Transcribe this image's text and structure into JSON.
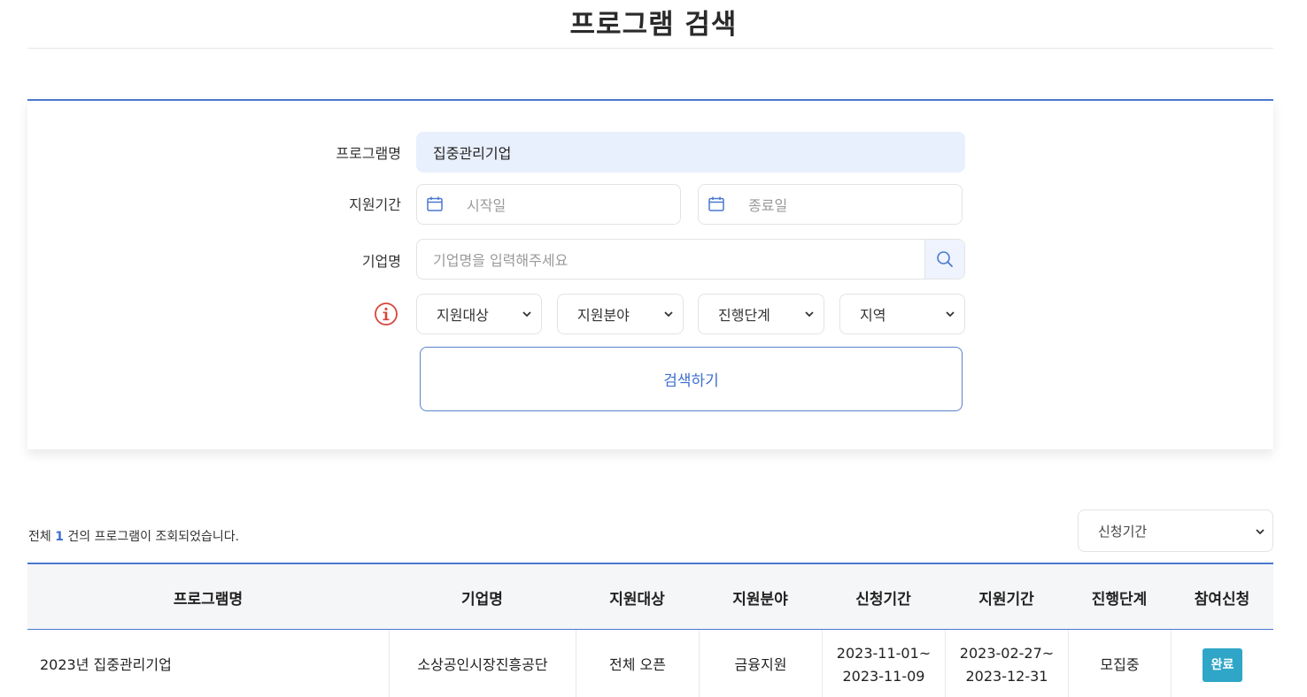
{
  "page": {
    "title": "프로그램 검색"
  },
  "search": {
    "program_label": "프로그램명",
    "program_value": "집중관리기업",
    "period_label": "지원기간",
    "start_placeholder": "시작일",
    "end_placeholder": "종료일",
    "company_label": "기업명",
    "company_placeholder": "기업명을 입력해주세요",
    "filters": [
      "지원대상",
      "지원분야",
      "진행단계",
      "지역"
    ],
    "submit_label": "검색하기"
  },
  "results": {
    "count_prefix": "전체",
    "count": "1",
    "count_suffix": "건의 프로그램이 조회되었습니다.",
    "sort_label": "신청기간"
  },
  "table": {
    "headers": [
      "프로그램명",
      "기업명",
      "지원대상",
      "지원분야",
      "신청기간",
      "지원기간",
      "진행단계",
      "참여신청"
    ],
    "rows": [
      {
        "program": "2023년 집중관리기업",
        "company": "소상공인시장진흥공단",
        "target": "전체 오픈",
        "field": "금융지원",
        "apply_start": "2023-11-01~",
        "apply_end": "2023-11-09",
        "support_start": "2023-02-27~",
        "support_end": "2023-12-31",
        "stage": "모집중",
        "action": "완료"
      }
    ]
  },
  "colors": {
    "accent": "#4a78d0",
    "badge": "#2fa6c7",
    "filled_input": "#e9f0fd",
    "info": "#d9443d"
  }
}
